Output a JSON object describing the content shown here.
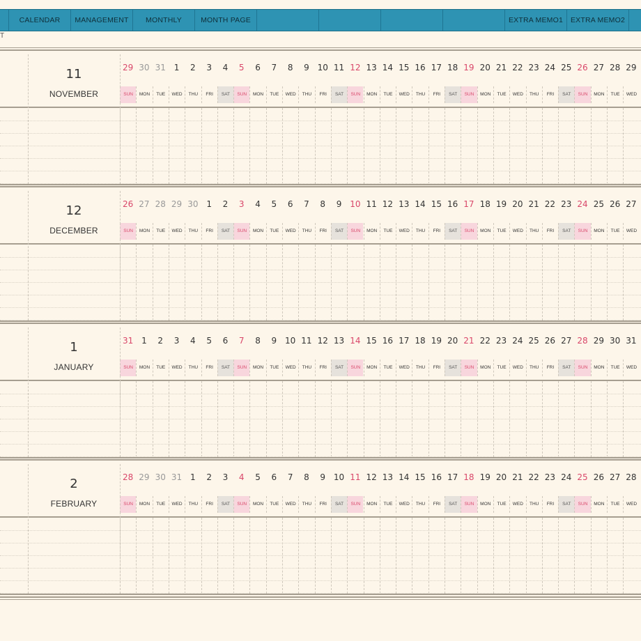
{
  "nav": {
    "tabs": [
      {
        "label": "CALENDAR"
      },
      {
        "label": "MANAGEMENT"
      },
      {
        "label": "MONTHLY"
      },
      {
        "label": "MONTH PAGE"
      },
      {
        "label": ""
      },
      {
        "label": ""
      },
      {
        "label": ""
      },
      {
        "label": ""
      },
      {
        "label": "EXTRA MEMO1"
      },
      {
        "label": "EXTRA MEMO2"
      },
      {
        "label": ""
      }
    ],
    "sub_label": "T"
  },
  "colors": {
    "bar": "#2e93b3",
    "background": "#fdf6ea",
    "sunday": "#d9476a",
    "sunday_bg": "#f8d6dd",
    "saturday_bg": "#e6e2dc"
  },
  "months": [
    {
      "number": "11",
      "name": "NOVEMBER",
      "days": [
        {
          "d": "29",
          "w": "SUN",
          "p": 1
        },
        {
          "d": "30",
          "w": "MON",
          "p": 1
        },
        {
          "d": "31",
          "w": "TUE",
          "p": 1
        },
        {
          "d": "1",
          "w": "WED"
        },
        {
          "d": "2",
          "w": "THU"
        },
        {
          "d": "3",
          "w": "FRI"
        },
        {
          "d": "4",
          "w": "SAT"
        },
        {
          "d": "5",
          "w": "SUN"
        },
        {
          "d": "6",
          "w": "MON"
        },
        {
          "d": "7",
          "w": "TUE"
        },
        {
          "d": "8",
          "w": "WED"
        },
        {
          "d": "9",
          "w": "THU"
        },
        {
          "d": "10",
          "w": "FRI"
        },
        {
          "d": "11",
          "w": "SAT"
        },
        {
          "d": "12",
          "w": "SUN"
        },
        {
          "d": "13",
          "w": "MON"
        },
        {
          "d": "14",
          "w": "TUE"
        },
        {
          "d": "15",
          "w": "WED"
        },
        {
          "d": "16",
          "w": "THU"
        },
        {
          "d": "17",
          "w": "FRI"
        },
        {
          "d": "18",
          "w": "SAT"
        },
        {
          "d": "19",
          "w": "SUN"
        },
        {
          "d": "20",
          "w": "MON"
        },
        {
          "d": "21",
          "w": "TUE"
        },
        {
          "d": "22",
          "w": "WED"
        },
        {
          "d": "23",
          "w": "THU"
        },
        {
          "d": "24",
          "w": "FRI"
        },
        {
          "d": "25",
          "w": "SAT"
        },
        {
          "d": "26",
          "w": "SUN"
        },
        {
          "d": "27",
          "w": "MON"
        },
        {
          "d": "28",
          "w": "TUE"
        },
        {
          "d": "29",
          "w": "WED"
        }
      ]
    },
    {
      "number": "12",
      "name": "DECEMBER",
      "days": [
        {
          "d": "26",
          "w": "SUN",
          "p": 1
        },
        {
          "d": "27",
          "w": "MON",
          "p": 1
        },
        {
          "d": "28",
          "w": "TUE",
          "p": 1
        },
        {
          "d": "29",
          "w": "WED",
          "p": 1
        },
        {
          "d": "30",
          "w": "THU",
          "p": 1
        },
        {
          "d": "1",
          "w": "FRI"
        },
        {
          "d": "2",
          "w": "SAT"
        },
        {
          "d": "3",
          "w": "SUN"
        },
        {
          "d": "4",
          "w": "MON"
        },
        {
          "d": "5",
          "w": "TUE"
        },
        {
          "d": "6",
          "w": "WED"
        },
        {
          "d": "7",
          "w": "THU"
        },
        {
          "d": "8",
          "w": "FRI"
        },
        {
          "d": "9",
          "w": "SAT"
        },
        {
          "d": "10",
          "w": "SUN"
        },
        {
          "d": "11",
          "w": "MON"
        },
        {
          "d": "12",
          "w": "TUE"
        },
        {
          "d": "13",
          "w": "WED"
        },
        {
          "d": "14",
          "w": "THU"
        },
        {
          "d": "15",
          "w": "FRI"
        },
        {
          "d": "16",
          "w": "SAT"
        },
        {
          "d": "17",
          "w": "SUN"
        },
        {
          "d": "18",
          "w": "MON"
        },
        {
          "d": "19",
          "w": "TUE"
        },
        {
          "d": "20",
          "w": "WED"
        },
        {
          "d": "21",
          "w": "THU"
        },
        {
          "d": "22",
          "w": "FRI"
        },
        {
          "d": "23",
          "w": "SAT"
        },
        {
          "d": "24",
          "w": "SUN"
        },
        {
          "d": "25",
          "w": "MON"
        },
        {
          "d": "26",
          "w": "TUE"
        },
        {
          "d": "27",
          "w": "WED"
        }
      ]
    },
    {
      "number": "1",
      "name": "JANUARY",
      "days": [
        {
          "d": "31",
          "w": "SUN",
          "p": 1
        },
        {
          "d": "1",
          "w": "MON"
        },
        {
          "d": "2",
          "w": "TUE"
        },
        {
          "d": "3",
          "w": "WED"
        },
        {
          "d": "4",
          "w": "THU"
        },
        {
          "d": "5",
          "w": "FRI"
        },
        {
          "d": "6",
          "w": "SAT"
        },
        {
          "d": "7",
          "w": "SUN"
        },
        {
          "d": "8",
          "w": "MON"
        },
        {
          "d": "9",
          "w": "TUE"
        },
        {
          "d": "10",
          "w": "WED"
        },
        {
          "d": "11",
          "w": "THU"
        },
        {
          "d": "12",
          "w": "FRI"
        },
        {
          "d": "13",
          "w": "SAT"
        },
        {
          "d": "14",
          "w": "SUN"
        },
        {
          "d": "15",
          "w": "MON"
        },
        {
          "d": "16",
          "w": "TUE"
        },
        {
          "d": "17",
          "w": "WED"
        },
        {
          "d": "18",
          "w": "THU"
        },
        {
          "d": "19",
          "w": "FRI"
        },
        {
          "d": "20",
          "w": "SAT"
        },
        {
          "d": "21",
          "w": "SUN"
        },
        {
          "d": "22",
          "w": "MON"
        },
        {
          "d": "23",
          "w": "TUE"
        },
        {
          "d": "24",
          "w": "WED"
        },
        {
          "d": "25",
          "w": "THU"
        },
        {
          "d": "26",
          "w": "FRI"
        },
        {
          "d": "27",
          "w": "SAT"
        },
        {
          "d": "28",
          "w": "SUN"
        },
        {
          "d": "29",
          "w": "MON"
        },
        {
          "d": "30",
          "w": "TUE"
        },
        {
          "d": "31",
          "w": "WED"
        }
      ]
    },
    {
      "number": "2",
      "name": "FEBRUARY",
      "days": [
        {
          "d": "28",
          "w": "SUN",
          "p": 1
        },
        {
          "d": "29",
          "w": "MON",
          "p": 1
        },
        {
          "d": "30",
          "w": "TUE",
          "p": 1
        },
        {
          "d": "31",
          "w": "WED",
          "p": 1
        },
        {
          "d": "1",
          "w": "THU"
        },
        {
          "d": "2",
          "w": "FRI"
        },
        {
          "d": "3",
          "w": "SAT"
        },
        {
          "d": "4",
          "w": "SUN"
        },
        {
          "d": "5",
          "w": "MON"
        },
        {
          "d": "6",
          "w": "TUE"
        },
        {
          "d": "7",
          "w": "WED"
        },
        {
          "d": "8",
          "w": "THU"
        },
        {
          "d": "9",
          "w": "FRI"
        },
        {
          "d": "10",
          "w": "SAT"
        },
        {
          "d": "11",
          "w": "SUN"
        },
        {
          "d": "12",
          "w": "MON"
        },
        {
          "d": "13",
          "w": "TUE"
        },
        {
          "d": "14",
          "w": "WED"
        },
        {
          "d": "15",
          "w": "THU"
        },
        {
          "d": "16",
          "w": "FRI"
        },
        {
          "d": "17",
          "w": "SAT"
        },
        {
          "d": "18",
          "w": "SUN"
        },
        {
          "d": "19",
          "w": "MON"
        },
        {
          "d": "20",
          "w": "TUE"
        },
        {
          "d": "21",
          "w": "WED"
        },
        {
          "d": "22",
          "w": "THU"
        },
        {
          "d": "23",
          "w": "FRI"
        },
        {
          "d": "24",
          "w": "SAT"
        },
        {
          "d": "25",
          "w": "SUN"
        },
        {
          "d": "26",
          "w": "MON"
        },
        {
          "d": "27",
          "w": "TUE"
        },
        {
          "d": "28",
          "w": "WED"
        }
      ]
    }
  ]
}
